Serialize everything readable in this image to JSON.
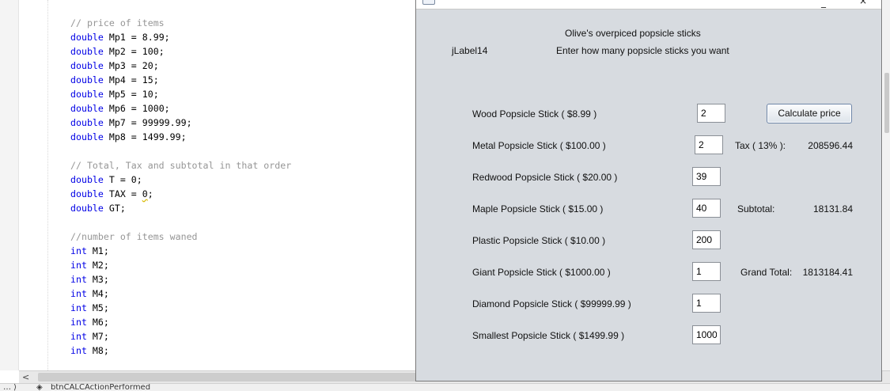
{
  "editor": {
    "code_lines": [
      {
        "type": "comment",
        "text": "// price of items"
      },
      {
        "type": "decl",
        "kw": "double",
        "rest": " Mp1 = 8.99;"
      },
      {
        "type": "decl",
        "kw": "double",
        "rest": " Mp2 = 100;"
      },
      {
        "type": "decl",
        "kw": "double",
        "rest": " Mp3 = 20;"
      },
      {
        "type": "decl",
        "kw": "double",
        "rest": " Mp4 = 15;"
      },
      {
        "type": "decl",
        "kw": "double",
        "rest": " Mp5 = 10;"
      },
      {
        "type": "decl",
        "kw": "double",
        "rest": " Mp6 = 1000;"
      },
      {
        "type": "decl",
        "kw": "double",
        "rest": " Mp7 = 99999.99;"
      },
      {
        "type": "decl",
        "kw": "double",
        "rest": " Mp8 = 1499.99;"
      },
      {
        "type": "blank",
        "text": ""
      },
      {
        "type": "comment",
        "text": "// Total, Tax and subtotal in that order"
      },
      {
        "type": "decl",
        "kw": "double",
        "rest": " T = 0;"
      },
      {
        "type": "decl_warn",
        "kw": "double",
        "pre": " TAX = ",
        "warn": "0",
        "post": ";"
      },
      {
        "type": "decl",
        "kw": "double",
        "rest": " GT;"
      },
      {
        "type": "blank",
        "text": ""
      },
      {
        "type": "comment",
        "text": "//number of items waned"
      },
      {
        "type": "decl",
        "kw": "int",
        "rest": " M1;"
      },
      {
        "type": "decl",
        "kw": "int",
        "rest": " M2;"
      },
      {
        "type": "decl",
        "kw": "int",
        "rest": " M3;"
      },
      {
        "type": "decl",
        "kw": "int",
        "rest": " M4;"
      },
      {
        "type": "decl",
        "kw": "int",
        "rest": " M5;"
      },
      {
        "type": "decl",
        "kw": "int",
        "rest": " M6;"
      },
      {
        "type": "decl",
        "kw": "int",
        "rest": " M7;"
      },
      {
        "type": "decl",
        "kw": "int",
        "rest": " M8;"
      }
    ],
    "scroll_left_arrow": "<",
    "navigator_path": "btnCALCActionPerformed"
  },
  "window": {
    "title_heading": "Olive's overpiced popsicle sticks",
    "image_label": "jLabel14",
    "instruction": "Enter how many popsicle sticks you want",
    "items": [
      {
        "label": "Wood Popsicle Stick ( $8.99 )",
        "qty": "2"
      },
      {
        "label": "Metal Popsicle Stick ( $100.00 )",
        "qty": "2"
      },
      {
        "label": "Redwood Popsicle Stick ( $20.00 )",
        "qty": "39"
      },
      {
        "label": "Maple Popsicle Stick ( $15.00 )",
        "qty": "40"
      },
      {
        "label": "Plastic Popsicle Stick ( $10.00 )",
        "qty": "200"
      },
      {
        "label": "Giant Popsicle Stick ( $1000.00 )",
        "qty": "1"
      },
      {
        "label": "Diamond Popsicle Stick ( $99999.99 )",
        "qty": "1"
      },
      {
        "label": "Smallest Popsicle Stick ( $1499.99 )",
        "qty": "1000"
      }
    ],
    "calculate_label": "Calculate price",
    "tax_label": "Tax ( 13% ):",
    "tax_value": "208596.44",
    "subtotal_label": "Subtotal:",
    "subtotal_value": "18131.84",
    "grandtotal_label": "Grand Total:",
    "grandtotal_value": "1813184.41",
    "minimize_glyph": "_",
    "close_glyph": "×"
  }
}
